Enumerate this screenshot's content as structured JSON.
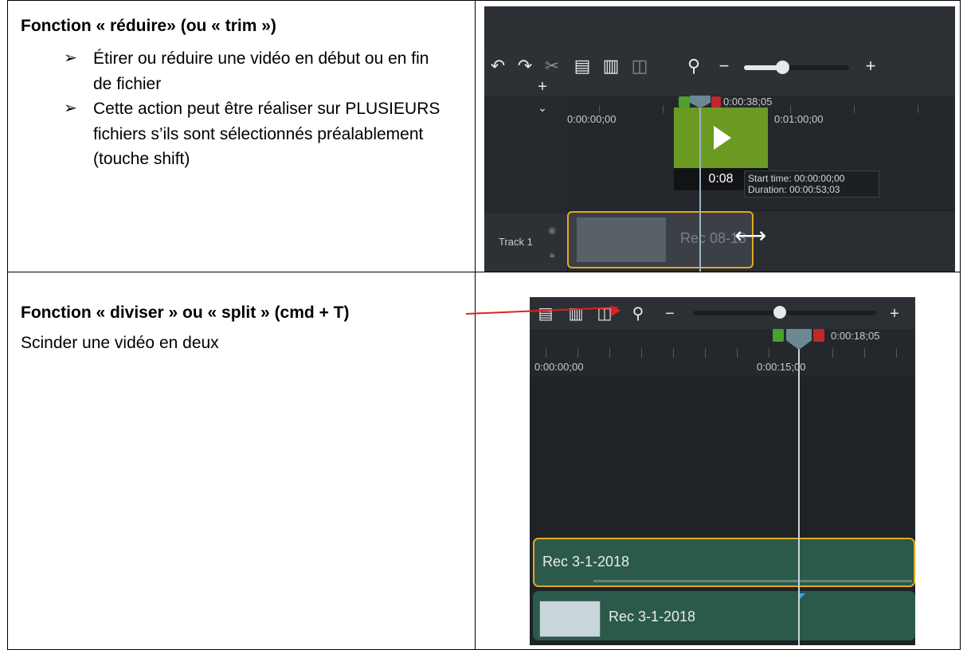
{
  "section_trim": {
    "title": "Fonction « réduire» (ou  « trim »)",
    "bullets": [
      "Étirer ou réduire une vidéo en début ou en fin de fichier",
      "Cette action peut être réaliser sur PLUSIEURS fichiers s’ils sont sélectionnés préalablement (touche shift)"
    ],
    "bullet_glyph": "➢"
  },
  "section_split": {
    "title": "Fonction « diviser » ou « split » (cmd + T)",
    "subtitle": "Scinder une vidéo en deux"
  },
  "screenshot_trim": {
    "playhead_time": "0:00:38;05",
    "ruler_labels": [
      "0:00:00;00",
      "0:01:00;00"
    ],
    "tooltip_time": "0:08",
    "start_time_label": "Start time:",
    "start_time_value": "00:00:00;00",
    "duration_label": "Duration:",
    "duration_value": "00:00:53;03",
    "track_label": "Track 1",
    "clip_title": "Rec 08-13",
    "icons": [
      "undo-icon",
      "redo-icon",
      "cut-icon",
      "copy-icon",
      "paste-icon",
      "split-icon",
      "zoom-icon",
      "minus-icon",
      "plus-icon"
    ]
  },
  "screenshot_split": {
    "playhead_time": "0:00:18;05",
    "ruler_labels": [
      "0:00:00;00",
      "0:00:15;00"
    ],
    "clip_a_title": "Rec 3-1-2018",
    "clip_b_title": "Rec 3-1-2018",
    "icons": [
      "copy-icon",
      "paste-icon",
      "split-icon",
      "zoom-icon",
      "minus-icon",
      "plus-icon"
    ]
  },
  "colors": {
    "annotation": "#e41f1f",
    "clip_selected_border": "#e3a822",
    "play_green": "#6b9a23",
    "clip_teal": "#2b5a4b"
  }
}
